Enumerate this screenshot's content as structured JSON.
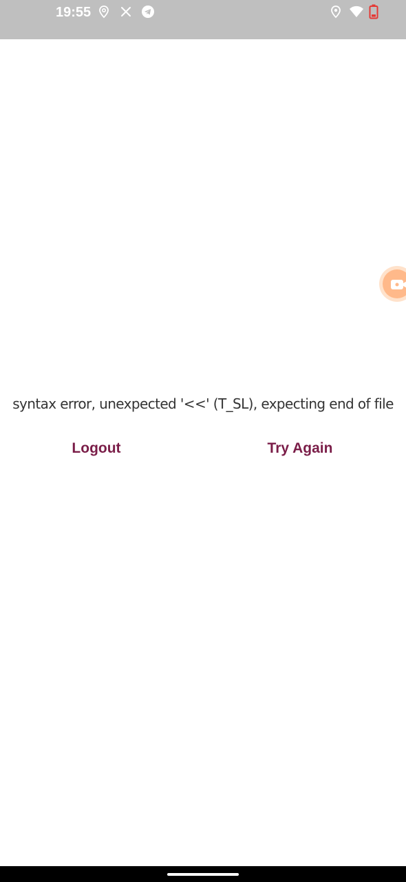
{
  "status_bar": {
    "time": "19:55",
    "left_icons": [
      "location-pin-outline-icon",
      "close-icon",
      "telegram-icon"
    ],
    "right_icons": [
      "location-pin-icon",
      "wifi-icon",
      "battery-low-icon"
    ],
    "colors": {
      "background": "#bfbfbf",
      "icon": "#ffffff",
      "battery_alert": "#e53935"
    }
  },
  "main": {
    "error_message": "syntax error, unexpected '<<' (T_SL), expecting end of file",
    "buttons": {
      "logout_label": "Logout",
      "try_again_label": "Try Again"
    },
    "colors": {
      "accent": "#7a1d48",
      "text": "#333333"
    }
  },
  "floating_bubble": {
    "icon": "video-camera-icon",
    "colors": {
      "outer": "#ffe2cb",
      "inner": "#ffb98a"
    }
  },
  "nav_bar": {
    "handle": "home-gesture-handle"
  }
}
